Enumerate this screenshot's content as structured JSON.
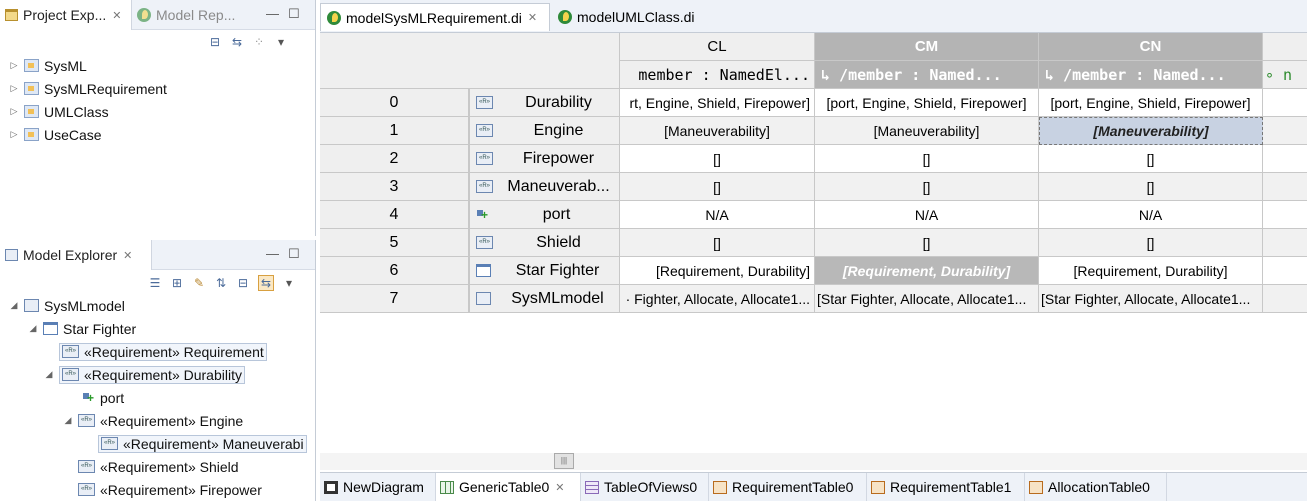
{
  "project_explorer": {
    "tab_label": "Project Exp...",
    "other_tab_label": "Model Rep...",
    "items": [
      {
        "label": "SysML"
      },
      {
        "label": "SysMLRequirement"
      },
      {
        "label": "UMLClass"
      },
      {
        "label": "UseCase"
      }
    ]
  },
  "model_explorer": {
    "tab_label": "Model Explorer",
    "tree": [
      {
        "label": "SysMLmodel",
        "icon": "model-icon"
      },
      {
        "label": "Star Fighter",
        "icon": "folder-icon"
      },
      {
        "label": "«Requirement» Requirement",
        "icon": "requirement-icon"
      },
      {
        "label": "«Requirement» Durability",
        "icon": "requirement-icon"
      },
      {
        "label": "port",
        "icon": "port-icon"
      },
      {
        "label": "«Requirement» Engine",
        "icon": "requirement-icon"
      },
      {
        "label": "«Requirement» Maneuverabi",
        "icon": "requirement-icon"
      },
      {
        "label": "«Requirement» Shield",
        "icon": "requirement-icon"
      },
      {
        "label": "«Requirement» Firepower",
        "icon": "requirement-icon"
      }
    ]
  },
  "editor_tabs": [
    {
      "label": "modelSysMLRequirement.di",
      "active": true
    },
    {
      "label": "modelUMLClass.di",
      "active": false
    }
  ],
  "table": {
    "columns": [
      {
        "id": "CL",
        "subheader": "member : NamedEl..."
      },
      {
        "id": "CM",
        "subheader": "↳ /member : Named..."
      },
      {
        "id": "CN",
        "subheader": "↳ /member : Named..."
      },
      {
        "id": "",
        "subheader": "∘ n"
      }
    ],
    "rows": [
      {
        "index": "0",
        "label": "Durability",
        "icon": "requirement-icon",
        "cells": [
          "rt, Engine, Shield, Firepower]",
          "[port, Engine, Shield, Firepower]",
          "[port, Engine, Shield, Firepower]"
        ]
      },
      {
        "index": "1",
        "label": "Engine",
        "icon": "requirement-icon",
        "cells": [
          "[Maneuverability]",
          "[Maneuverability]",
          "[Maneuverability]"
        ]
      },
      {
        "index": "2",
        "label": "Firepower",
        "icon": "requirement-icon",
        "cells": [
          "[]",
          "[]",
          "[]"
        ]
      },
      {
        "index": "3",
        "label": "Maneuverab...",
        "icon": "requirement-icon",
        "cells": [
          "[]",
          "[]",
          "[]"
        ]
      },
      {
        "index": "4",
        "label": "port",
        "icon": "port-icon",
        "cells": [
          "N/A",
          "N/A",
          "N/A"
        ]
      },
      {
        "index": "5",
        "label": "Shield",
        "icon": "requirement-icon",
        "cells": [
          "[]",
          "[]",
          "[]"
        ]
      },
      {
        "index": "6",
        "label": "Star Fighter",
        "icon": "folder-icon",
        "cells": [
          "[Requirement, Durability]",
          "[Requirement, Durability]",
          "[Requirement, Durability]"
        ]
      },
      {
        "index": "7",
        "label": "SysMLmodel",
        "icon": "model-icon",
        "cells": [
          "· Fighter, Allocate, Allocate1...",
          "[Star Fighter, Allocate, Allocate1...",
          "[Star Fighter, Allocate, Allocate1..."
        ]
      }
    ]
  },
  "bottom_tabs": [
    {
      "label": "NewDiagram",
      "icon": "diagram-icon"
    },
    {
      "label": "GenericTable0",
      "icon": "generic-table-icon",
      "active": true
    },
    {
      "label": "TableOfViews0",
      "icon": "table-of-views-icon"
    },
    {
      "label": "RequirementTable0",
      "icon": "requirement-table-icon"
    },
    {
      "label": "RequirementTable1",
      "icon": "requirement-table-icon"
    },
    {
      "label": "AllocationTable0",
      "icon": "requirement-table-icon"
    }
  ],
  "colors": {
    "selected_header": "#b4b4b4",
    "selected_cell": "#c8d2e2",
    "row_shade": "#f1f1f1"
  }
}
